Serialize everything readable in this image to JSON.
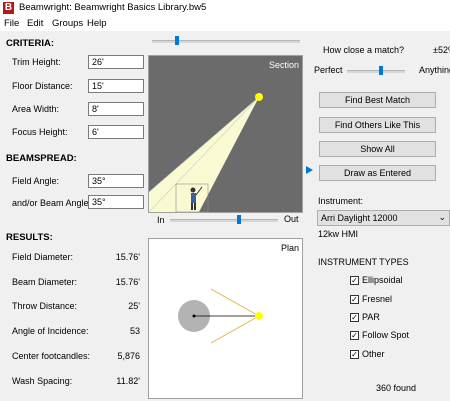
{
  "window": {
    "title": "Beamwright: Beamwright Basics Library.bw5",
    "app_icon_letter": "B"
  },
  "menu": [
    "File",
    "Edit",
    "Groups",
    "Help"
  ],
  "criteria": {
    "heading": "CRITERIA:",
    "trim_height": {
      "label": "Trim Height:",
      "value": "26'"
    },
    "floor_distance": {
      "label": "Floor Distance:",
      "value": "15'"
    },
    "area_width": {
      "label": "Area Width:",
      "value": "8'"
    },
    "focus_height": {
      "label": "Focus Height:",
      "value": "6'"
    }
  },
  "beamspread": {
    "heading": "BEAMSPREAD:",
    "field_angle": {
      "label": "Field Angle:",
      "value": "35°"
    },
    "beam_angle": {
      "label": "and/or Beam Angle:",
      "value": "35°"
    }
  },
  "results": {
    "heading": "RESULTS:",
    "rows": [
      {
        "label": "Field Diameter:",
        "value": "15.76'"
      },
      {
        "label": "Beam Diameter:",
        "value": "15.76'"
      },
      {
        "label": "Throw Distance:",
        "value": "25'"
      },
      {
        "label": "Angle of Incidence:",
        "value": "53"
      },
      {
        "label": "Center footcandles:",
        "value": "5,876"
      },
      {
        "label": "Wash Spacing:",
        "value": "11.82'"
      }
    ]
  },
  "section_view": {
    "label": "Section"
  },
  "plan_view": {
    "label": "Plan"
  },
  "in_out_slider": {
    "in_label": "In",
    "out_label": "Out",
    "position": 0.64
  },
  "top_slider": {
    "position": 0.16
  },
  "match": {
    "question": "How close a match?",
    "percent": "±52%",
    "perfect_label": "Perfect",
    "anything_label": "Anything",
    "position": 0.6
  },
  "buttons": {
    "find_best": "Find Best Match",
    "find_others": "Find Others Like This",
    "show_all": "Show All",
    "draw_as_entered": "Draw as Entered"
  },
  "instrument": {
    "label": "Instrument:",
    "selected": "Arri Daylight 12000",
    "subtitle": "12kw HMI"
  },
  "instrument_types": {
    "heading": "INSTRUMENT TYPES",
    "items": [
      {
        "label": "Ellipsoidal",
        "checked": true
      },
      {
        "label": "Fresnel",
        "checked": true
      },
      {
        "label": "PAR",
        "checked": true
      },
      {
        "label": "Follow Spot",
        "checked": true
      },
      {
        "label": "Other",
        "checked": true
      }
    ]
  },
  "found_count": "360 found",
  "colors": {
    "accent": "#0078d7",
    "lamp": "#ffff00",
    "section_bg": "#6b6b6b",
    "beam": "#fafad2"
  },
  "icons": {
    "dropdown": "chevron-down-icon",
    "check": "check-icon"
  }
}
